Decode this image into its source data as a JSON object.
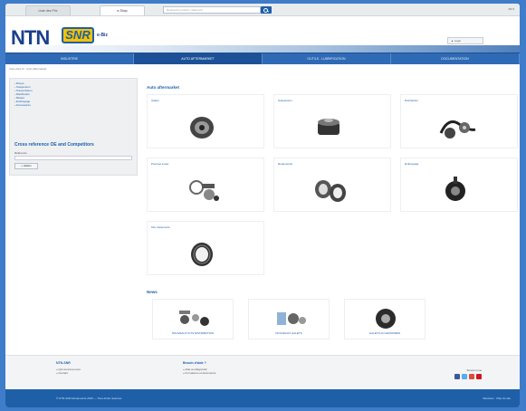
{
  "topbar": {
    "tabs": [
      "Liste des Prix",
      "e-Shop"
    ],
    "search_placeholder": "Recherche produit / référence",
    "lang": "FR ▾"
  },
  "header": {
    "logo_ntn": "NTN",
    "logo_snr": "SNR",
    "ebiz": "e-Biz",
    "login": "▲ Login"
  },
  "nav": [
    "INDUSTRIE",
    "AUTO AFTERMARKET",
    "OUTILS - LUBRIFICATION",
    "DOCUMENTATION"
  ],
  "breadcrumb": "Vous êtes ici : Auto aftermarket",
  "sidebar": {
    "items": [
      "Roues",
      "Suspension",
      "Transmission",
      "Distribution",
      "Moteur",
      "Embrayage",
      "Accessoires"
    ],
    "xref_title": "Cross reference OE and Competitors",
    "xref_label": "Référence",
    "xref_button": "» Valider"
  },
  "main": {
    "title": "Auto aftermarket",
    "cards": [
      "Galets",
      "Suspension",
      "Distribution",
      "Pompes à eau",
      "Roulements",
      "Embrayage",
      "Kits roulements"
    ],
    "news_title": "News",
    "news": [
      "NOUVEAUX KITS DISTRIBUTION",
      "NOUVEAUX GALETS",
      "GALETS ACCESSOIRES"
    ]
  },
  "footer": {
    "col1": {
      "h": "NTN-SNR",
      "items": [
        "» Qui sommes-nous",
        "» Contact"
      ]
    },
    "col2": {
      "h": "Besoin d'aide ?",
      "items": [
        "» Aide au diagnostic",
        "» Formations et documents"
      ]
    },
    "follow": "Suivez-nous",
    "copyright": "© NTN-SNR Roulements 2015 — Tous droits réservés",
    "right": "Mentions · Plan du site"
  }
}
